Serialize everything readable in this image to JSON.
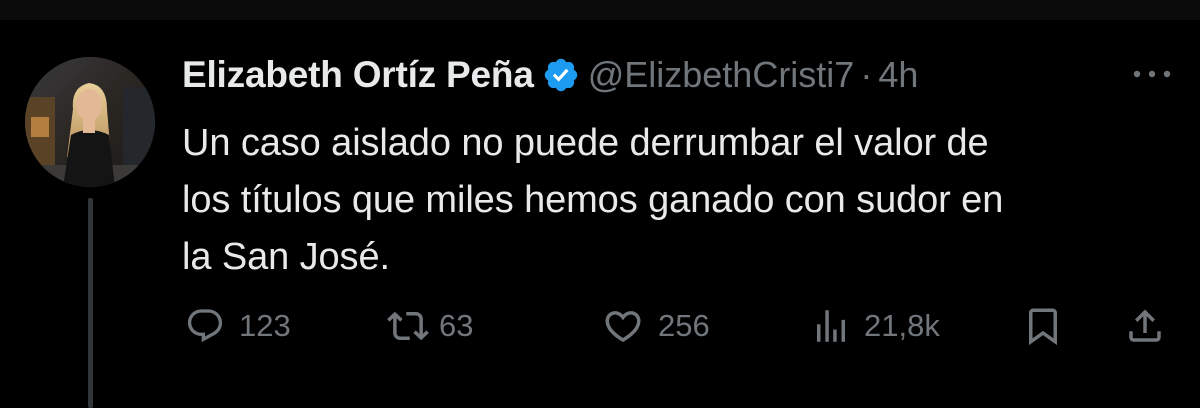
{
  "tweet": {
    "author_name": "Elizabeth Ortíz Peña",
    "handle": "@ElizbethCristi7",
    "separator": "·",
    "time_ago": "4h",
    "text_lines": [
      "Un caso aislado no puede derrumbar el valor de",
      "los títulos que miles hemos ganado con sudor en",
      "la San José."
    ],
    "verified": true
  },
  "actions": {
    "replies": "123",
    "reposts": "63",
    "likes": "256",
    "views": "21,8k"
  },
  "icons": {
    "verified": "verified-badge-icon",
    "more": "more-options-icon",
    "reply": "reply-icon",
    "repost": "repost-icon",
    "like": "heart-icon",
    "views": "views-chart-icon",
    "bookmark": "bookmark-icon",
    "share": "share-icon"
  },
  "colors": {
    "background": "#000000",
    "text_primary": "#e7e9ea",
    "text_secondary": "#71767b",
    "verified_blue": "#1d9bf0",
    "thread_line": "#333639"
  }
}
